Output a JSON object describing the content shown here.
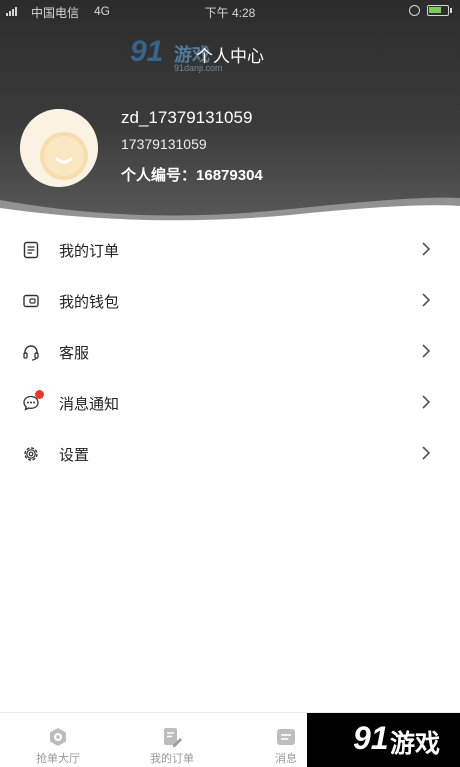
{
  "status_bar": {
    "carrier": "中国电信",
    "network": "4G",
    "time": "下午 4:28"
  },
  "header": {
    "title": "个人中心"
  },
  "profile": {
    "username": "zd_17379131059",
    "phone": "17379131059",
    "member_id_label": "个人编号：",
    "member_id": "16879304"
  },
  "menu": {
    "items": [
      {
        "label": "我的订单",
        "icon": "order-list-icon"
      },
      {
        "label": "我的钱包",
        "icon": "wallet-icon"
      },
      {
        "label": "客服",
        "icon": "headset-icon"
      },
      {
        "label": "消息通知",
        "icon": "message-bubble-icon",
        "has_badge": true
      },
      {
        "label": "设置",
        "icon": "gear-icon"
      }
    ]
  },
  "tab_bar": {
    "tabs": [
      {
        "label": "抢单大厅",
        "icon": "hall-icon"
      },
      {
        "label": "我的订单",
        "icon": "order-edit-icon"
      },
      {
        "label": "消息",
        "icon": "message-icon"
      }
    ]
  },
  "watermark": {
    "number": "91",
    "name": "游戏",
    "url": "91danji.com"
  },
  "colors": {
    "header_dark": "#2c2c2c",
    "badge_red": "#e03c2e",
    "text_primary": "#222222",
    "tab_text": "#9a9a9a"
  }
}
